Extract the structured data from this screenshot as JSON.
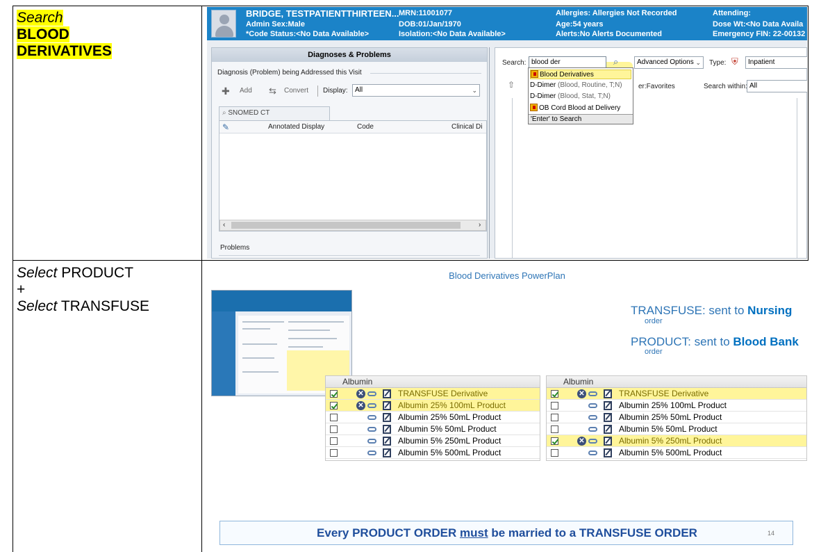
{
  "steps": [
    {
      "verb": "Search",
      "object_line1": "BLOOD",
      "object_line2": "DERIVATIVES"
    },
    {
      "verb1": "Select",
      "object1": "PRODUCT",
      "plus": "+",
      "verb2": "Select",
      "object2": "TRANSFUSE"
    }
  ],
  "colors": {
    "highlight": "#ffff00",
    "banner_blue": "#1b83c8",
    "slide_blue": "#2e75b6",
    "callout_blue": "#0070c0"
  },
  "patient_banner": {
    "name": "BRIDGE, TESTPATIENTTHIRTEEN...",
    "sex": "Admin Sex:Male",
    "code_status": "*Code Status:<No Data Available>",
    "mrn": "MRN:11001077",
    "dob": "DOB:01/Jan/1970",
    "isolation": "Isolation:<No Data Available>",
    "allergies": "Allergies: Allergies Not Recorded",
    "age": "Age:54 years",
    "alerts": "Alerts:No Alerts Documented",
    "attending": "Attending:",
    "dose_wt": "Dose Wt:<No Data Availa",
    "emergency_fin": "Emergency FIN: 22-00132"
  },
  "diagnoses_pane": {
    "title": "Diagnoses & Problems",
    "section_label": "Diagnosis (Problem) being Addressed this Visit",
    "add": "Add",
    "convert": "Convert",
    "display_label": "Display:",
    "display_value": "All",
    "tab": "SNOMED CT",
    "col_annotated": "Annotated Display",
    "col_code": "Code",
    "col_clinical": "Clinical Di",
    "problems_label": "Problems"
  },
  "orders_pane": {
    "search_label": "Search:",
    "search_value": "blood der",
    "advanced_options": "Advanced Options",
    "type_label": "Type:",
    "type_value": "Inpatient",
    "folder_label": "er:Favorites",
    "search_within_label": "Search within:",
    "search_within_value": "All",
    "suggestions": [
      {
        "main": "Blood Derivatives",
        "detail": ""
      },
      {
        "main": "D-Dimer",
        "detail": "(Blood, Routine, T;N)"
      },
      {
        "main": "D-Dimer",
        "detail": "(Blood, Stat, T;N)"
      },
      {
        "main": "OB Cord Blood at Delivery",
        "detail": ""
      }
    ],
    "enter_hint": "'Enter' to Search"
  },
  "slide": {
    "title": "Blood Derivatives PowerPlan",
    "callout1": {
      "lead": "TRANSFUSE: sent to ",
      "target": "Nursing",
      "sub": "order"
    },
    "callout2": {
      "lead": "PRODUCT: sent to ",
      "target": "Blood Bank",
      "sub": "order"
    },
    "left_table": {
      "header": "Albumin",
      "rows": [
        {
          "label": "TRANSFUSE Derivative",
          "checked": true,
          "highlight": true
        },
        {
          "label": "Albumin 25% 100mL Product",
          "checked": true,
          "highlight": true
        },
        {
          "label": "Albumin 25% 50mL Product",
          "checked": false,
          "highlight": false
        },
        {
          "label": "Albumin 5% 50mL Product",
          "checked": false,
          "highlight": false
        },
        {
          "label": "Albumin 5% 250mL Product",
          "checked": false,
          "highlight": false
        },
        {
          "label": "Albumin 5% 500mL Product",
          "checked": false,
          "highlight": false
        }
      ]
    },
    "right_table": {
      "header": "Albumin",
      "rows": [
        {
          "label": "TRANSFUSE Derivative",
          "checked": true,
          "highlight": true
        },
        {
          "label": "Albumin 25% 100mL Product",
          "checked": false,
          "highlight": false
        },
        {
          "label": "Albumin 25% 50mL Product",
          "checked": false,
          "highlight": false
        },
        {
          "label": "Albumin 5% 50mL Product",
          "checked": false,
          "highlight": false
        },
        {
          "label": "Albumin 5% 250mL Product",
          "checked": true,
          "highlight": true
        },
        {
          "label": "Albumin 5% 500mL Product",
          "checked": false,
          "highlight": false
        }
      ]
    },
    "bottom_banner": {
      "lead": "Every PRODUCT ORDER ",
      "must": "must",
      "tail": " be married to a TRANSFUSE ORDER"
    },
    "page_number": "14"
  }
}
